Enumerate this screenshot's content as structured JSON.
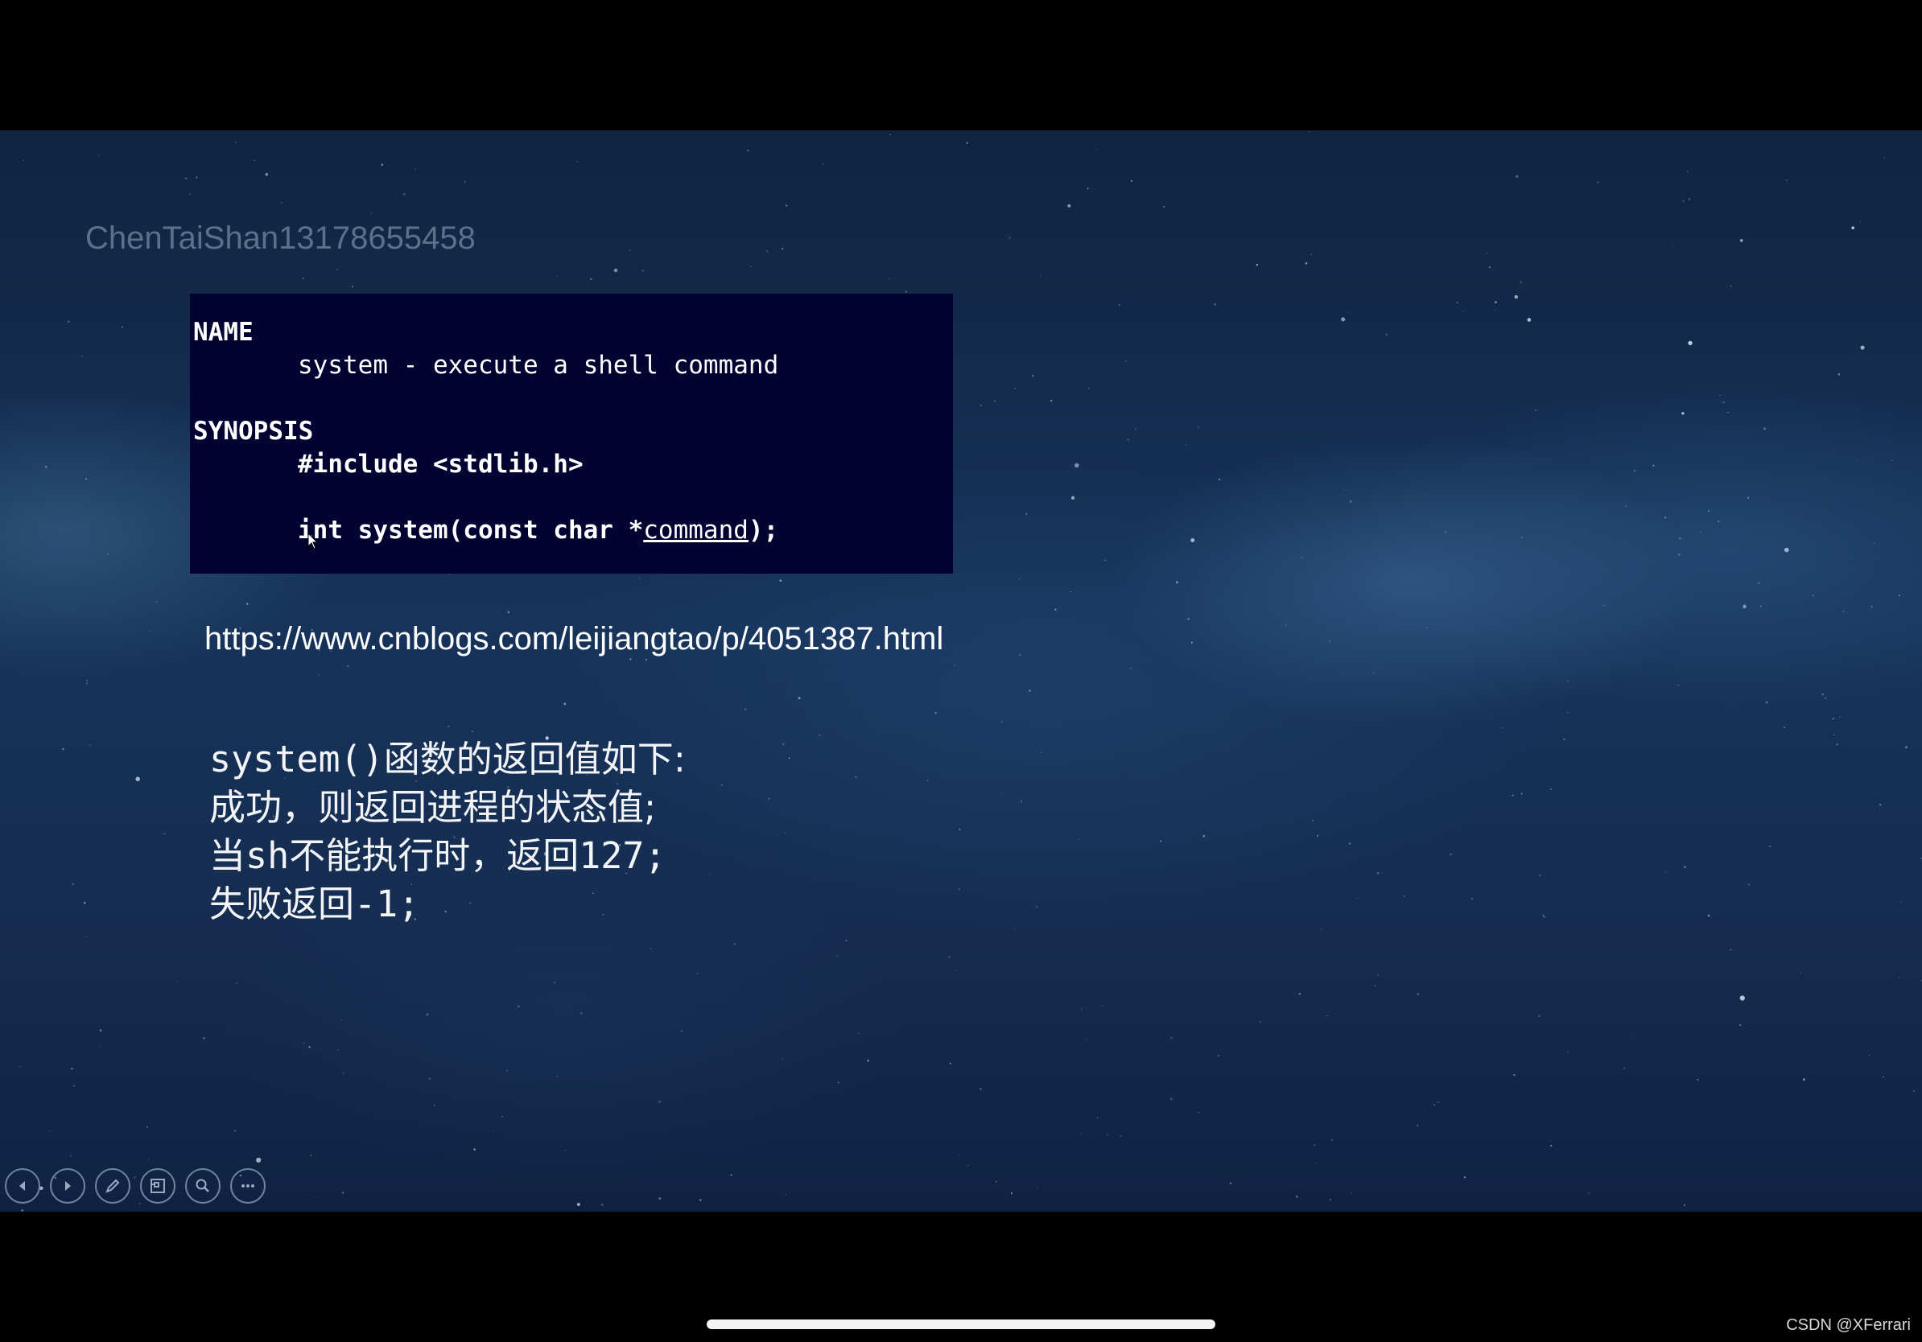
{
  "slide": {
    "watermark": "ChenTaiShan13178655458",
    "manpage": {
      "name_heading": "NAME",
      "name_desc": "system - execute a shell command",
      "synopsis_heading": "SYNOPSIS",
      "include_line": "#include <stdlib.h>",
      "signature_prefix": "int system(const char *",
      "signature_param": "command",
      "signature_suffix": ");"
    },
    "url": "https://www.cnblogs.com/leijiangtao/p/4051387.html",
    "notes": {
      "line1_code": "system()",
      "line1_text": "函数的返回值如下:",
      "line2": "成功，则返回进程的状态值;",
      "line3_a": "当",
      "line3_code": "sh",
      "line3_b": "不能执行时，返回",
      "line3_num": "127;",
      "line4_text": "失败返回",
      "line4_num": "-1;"
    }
  },
  "toolbar": {
    "buttons": [
      {
        "icon": "previous-slide-icon"
      },
      {
        "icon": "next-slide-icon"
      },
      {
        "icon": "pen-icon"
      },
      {
        "icon": "slide-sorter-icon"
      },
      {
        "icon": "zoom-icon"
      },
      {
        "icon": "more-options-icon"
      }
    ]
  },
  "footer": {
    "credit": "CSDN @XFerrari"
  },
  "colors": {
    "manpage_bg": "#030332",
    "slide_bg": "#17335a",
    "frame": "#000000"
  }
}
